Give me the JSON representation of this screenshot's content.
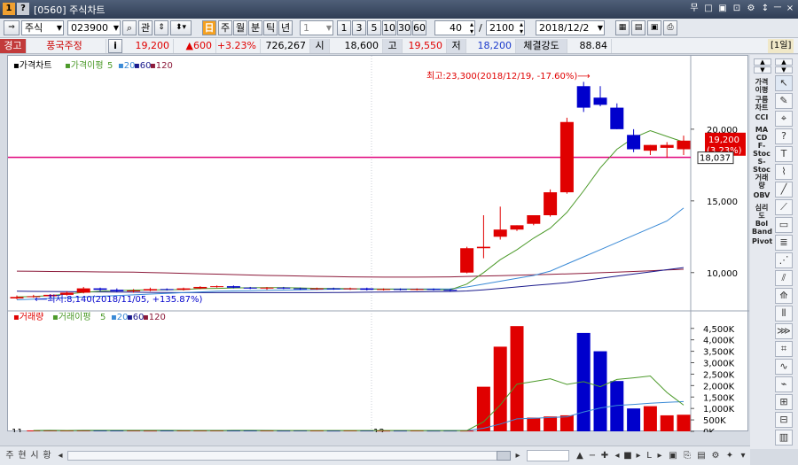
{
  "window": {
    "icon_num": "1",
    "icon_help": "?",
    "title": "[0560] 주식차트",
    "buttons": [
      "무",
      "□",
      "▣",
      "⊡",
      "⚙",
      "↕",
      "ㅡ",
      "×"
    ]
  },
  "toolbar": {
    "market": "주식",
    "code": "023900",
    "btn_gwan": "관",
    "periods": [
      "주",
      "월",
      "분",
      "틱",
      "년"
    ],
    "interval": "1",
    "quick": [
      "1",
      "3",
      "5",
      "10",
      "30",
      "60"
    ],
    "count": "40",
    "total": "2100",
    "date": "2018/12/2"
  },
  "quote": {
    "tag": "경고",
    "name": "풍국주정",
    "info": "i",
    "price": "19,200",
    "change": "▲600",
    "pct": "+3.23%",
    "volume": "726,267",
    "open_label": "시",
    "open": "18,600",
    "high_label": "고",
    "high": "19,550",
    "low_label": "저",
    "low": "18,200",
    "strength_label": "체결강도",
    "strength": "88.84",
    "period": "[1일]"
  },
  "chart": {
    "price_legend": {
      "title": "가격차트",
      "ma_label": "가격이평",
      "ma": [
        "5",
        "20",
        "60",
        "120"
      ]
    },
    "vol_legend": {
      "title": "거래량",
      "ma_label": "거래이평",
      "ma": [
        "5",
        "20",
        "60",
        "120"
      ]
    },
    "high_annotation": "최고:23,300(2018/12/19, -17.60%)⟶",
    "low_annotation": "⟵최저:8,140(2018/11/05, +135.87%)",
    "price_ticks": [
      "20,000",
      "15,000",
      "10,000"
    ],
    "vol_ticks": [
      "4,500K",
      "4,000K",
      "3,500K",
      "3,000K",
      "2,500K",
      "2,000K",
      "1,500K",
      "1,000K",
      "500K",
      "0K"
    ],
    "current_price": "19,200",
    "current_pct": "(3.23%)",
    "line_value": "18,037",
    "x_ticks": [
      "11",
      "12"
    ]
  },
  "colors": {
    "up": "#e00000",
    "down": "#0000cc",
    "ma5": "#4c9a2a",
    "ma20": "#3a8ad6",
    "ma60": "#1a1a8c",
    "ma120": "#8c1a3a",
    "hline": "#e0007a"
  },
  "chart_data": {
    "type": "candlestick",
    "ohlc": [
      {
        "o": 8200,
        "h": 8400,
        "l": 8140,
        "c": 8300
      },
      {
        "o": 8300,
        "h": 8450,
        "l": 8250,
        "c": 8350
      },
      {
        "o": 8350,
        "h": 8500,
        "l": 8300,
        "c": 8450
      },
      {
        "o": 8450,
        "h": 8700,
        "l": 8400,
        "c": 8600
      },
      {
        "o": 8600,
        "h": 9000,
        "l": 8550,
        "c": 8900
      },
      {
        "o": 8900,
        "h": 8950,
        "l": 8700,
        "c": 8800
      },
      {
        "o": 8800,
        "h": 8900,
        "l": 8650,
        "c": 8700
      },
      {
        "o": 8700,
        "h": 8850,
        "l": 8600,
        "c": 8750
      },
      {
        "o": 8750,
        "h": 8950,
        "l": 8700,
        "c": 8850
      },
      {
        "o": 8850,
        "h": 8900,
        "l": 8750,
        "c": 8800
      },
      {
        "o": 8800,
        "h": 8950,
        "l": 8750,
        "c": 8900
      },
      {
        "o": 8900,
        "h": 9050,
        "l": 8850,
        "c": 9000
      },
      {
        "o": 9000,
        "h": 9100,
        "l": 8950,
        "c": 9050
      },
      {
        "o": 9050,
        "h": 9100,
        "l": 8900,
        "c": 8950
      },
      {
        "o": 8950,
        "h": 9000,
        "l": 8850,
        "c": 8900
      },
      {
        "o": 8900,
        "h": 9000,
        "l": 8800,
        "c": 8950
      },
      {
        "o": 8950,
        "h": 9000,
        "l": 8850,
        "c": 8900
      },
      {
        "o": 8900,
        "h": 8950,
        "l": 8800,
        "c": 8850
      },
      {
        "o": 8850,
        "h": 8950,
        "l": 8800,
        "c": 8900
      },
      {
        "o": 8900,
        "h": 8950,
        "l": 8800,
        "c": 8850
      },
      {
        "o": 8850,
        "h": 8950,
        "l": 8800,
        "c": 8900
      },
      {
        "o": 8900,
        "h": 8950,
        "l": 8750,
        "c": 8800
      },
      {
        "o": 8800,
        "h": 8900,
        "l": 8750,
        "c": 8850
      },
      {
        "o": 8850,
        "h": 8900,
        "l": 8750,
        "c": 8800
      },
      {
        "o": 8800,
        "h": 8900,
        "l": 8750,
        "c": 8850
      },
      {
        "o": 8850,
        "h": 8900,
        "l": 8750,
        "c": 8800
      },
      {
        "o": 8800,
        "h": 8850,
        "l": 8700,
        "c": 8750
      },
      {
        "o": 10000,
        "h": 11800,
        "l": 9950,
        "c": 11700
      },
      {
        "o": 11700,
        "h": 14000,
        "l": 11000,
        "c": 11800
      },
      {
        "o": 12500,
        "h": 14600,
        "l": 12300,
        "c": 13000
      },
      {
        "o": 13000,
        "h": 13300,
        "l": 12900,
        "c": 13300
      },
      {
        "o": 13400,
        "h": 14000,
        "l": 13300,
        "c": 14000
      },
      {
        "o": 14000,
        "h": 15800,
        "l": 13900,
        "c": 15600
      },
      {
        "o": 15600,
        "h": 20800,
        "l": 15500,
        "c": 20500
      },
      {
        "o": 23000,
        "h": 23300,
        "l": 21200,
        "c": 21500
      },
      {
        "o": 22200,
        "h": 23000,
        "l": 21600,
        "c": 21700
      },
      {
        "o": 21500,
        "h": 21800,
        "l": 20000,
        "c": 20000
      },
      {
        "o": 19600,
        "h": 20000,
        "l": 18400,
        "c": 18600
      },
      {
        "o": 18500,
        "h": 18900,
        "l": 18200,
        "c": 18900
      },
      {
        "o": 18700,
        "h": 19100,
        "l": 18000,
        "c": 18900
      },
      {
        "o": 18600,
        "h": 19550,
        "l": 18200,
        "c": 19200
      }
    ],
    "volume": [
      40,
      42,
      38,
      45,
      50,
      40,
      38,
      35,
      42,
      40,
      38,
      45,
      40,
      42,
      38,
      36,
      40,
      38,
      36,
      40,
      38,
      35,
      36,
      38,
      35,
      36,
      34,
      1950,
      3700,
      4600,
      600,
      650,
      700,
      4300,
      3500,
      2200,
      1000,
      1100,
      700,
      726
    ],
    "ma5": [
      8300,
      8330,
      8400,
      8500,
      8620,
      8700,
      8750,
      8780,
      8800,
      8800,
      8820,
      8880,
      8900,
      8930,
      8940,
      8950,
      8950,
      8930,
      8900,
      8890,
      8880,
      8860,
      8850,
      8840,
      8830,
      8820,
      8800,
      9200,
      10000,
      10900,
      11600,
      12400,
      13100,
      14200,
      15700,
      17300,
      18600,
      19400,
      19900,
      19500,
      19100
    ],
    "ma20": [
      8100,
      8150,
      8200,
      8250,
      8300,
      8350,
      8400,
      8450,
      8500,
      8550,
      8600,
      8650,
      8700,
      8720,
      8740,
      8760,
      8780,
      8800,
      8820,
      8840,
      8850,
      8850,
      8850,
      8860,
      8860,
      8860,
      8870,
      9000,
      9200,
      9400,
      9600,
      9800,
      10100,
      10600,
      11100,
      11600,
      12100,
      12600,
      13100,
      13600,
      14500
    ],
    "ma60": [
      8700,
      8690,
      8680,
      8670,
      8660,
      8650,
      8640,
      8630,
      8620,
      8610,
      8600,
      8600,
      8600,
      8600,
      8600,
      8600,
      8600,
      8600,
      8600,
      8610,
      8620,
      8630,
      8640,
      8650,
      8660,
      8670,
      8680,
      8720,
      8800,
      8900,
      9000,
      9100,
      9200,
      9300,
      9450,
      9600,
      9750,
      9900,
      10050,
      10200,
      10350
    ],
    "ma120": [
      10100,
      10090,
      10080,
      10070,
      10060,
      10050,
      10040,
      10030,
      10000,
      9980,
      9950,
      9920,
      9890,
      9860,
      9830,
      9800,
      9780,
      9760,
      9740,
      9720,
      9700,
      9690,
      9680,
      9680,
      9680,
      9690,
      9700,
      9730,
      9760,
      9790,
      9820,
      9850,
      9880,
      9910,
      9950,
      9990,
      10030,
      10080,
      10130,
      10180,
      10230
    ],
    "ylim": [
      7700,
      24500
    ],
    "vol_ylim": [
      0,
      4800
    ]
  }
}
